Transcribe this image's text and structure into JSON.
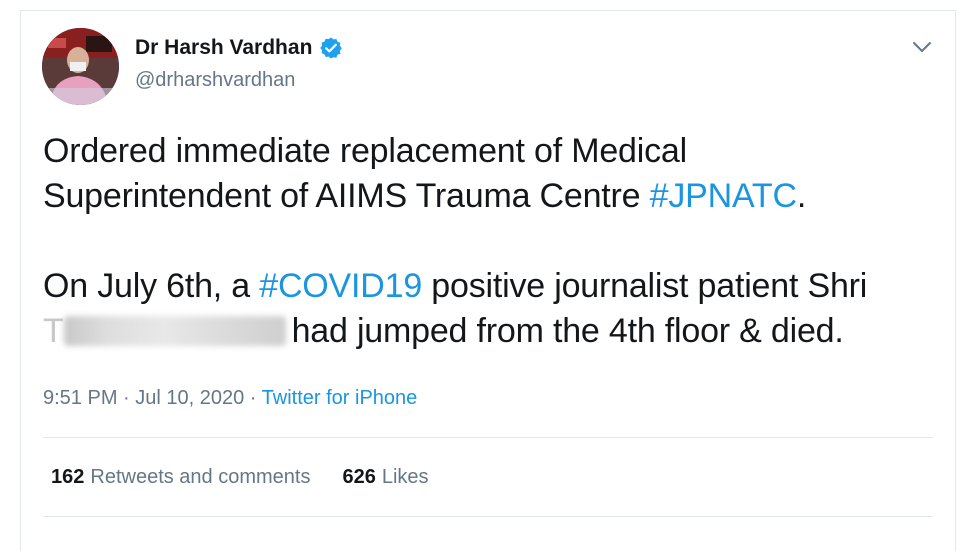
{
  "user": {
    "display_name": "Dr Harsh Vardhan",
    "handle": "@drharshvardhan",
    "verified": true,
    "avatar_icon": "avatar"
  },
  "tweet": {
    "line1_a": "Ordered immediate replacement of Medical",
    "line1_b": "Superintendent of AIIMS Trauma Centre ",
    "hashtag1": "#JPNATC",
    "line1_c": ".",
    "line2_a": "On July 6th, a ",
    "hashtag2": "#COVID19",
    "line2_b": " positive journalist patient Shri",
    "redacted_letter": "T",
    "line2_c": "had jumped from the 4th floor & died."
  },
  "meta": {
    "time": "9:51 PM",
    "sep1": " · ",
    "date": "Jul 10, 2020",
    "sep2": " · ",
    "source": "Twitter for iPhone"
  },
  "stats": {
    "retweets_count": "162",
    "retweets_label": "Retweets and comments",
    "likes_count": "626",
    "likes_label": "Likes"
  },
  "colors": {
    "link": "#1b95e0",
    "text": "#14171a",
    "muted": "#657786",
    "verified": "#1da1f2",
    "border": "#e1e8ed"
  }
}
